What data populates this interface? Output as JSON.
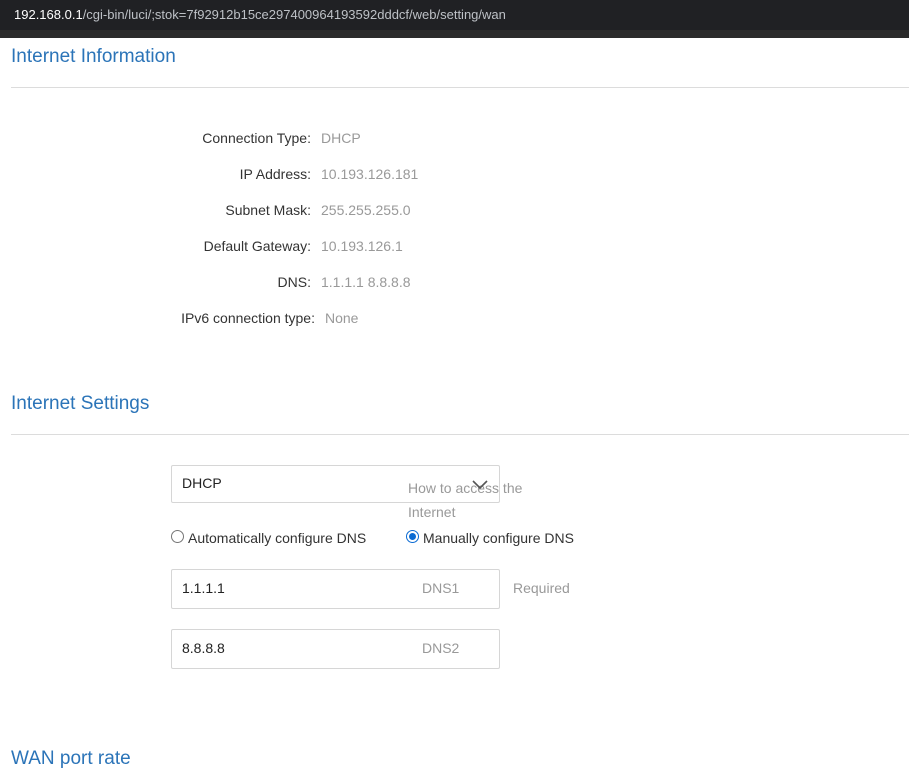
{
  "browser": {
    "url_host": "192.168.0.1",
    "url_path": "/cgi-bin/luci/;stok=7f92912b15ce297400964193592dddcf/web/setting/wan"
  },
  "internet_info": {
    "title": "Internet Information",
    "rows": [
      {
        "label": "Connection Type:",
        "value": "DHCP"
      },
      {
        "label": "IP Address:",
        "value": "10.193.126.181"
      },
      {
        "label": "Subnet Mask:",
        "value": "255.255.255.0"
      },
      {
        "label": "Default Gateway:",
        "value": "10.193.126.1"
      },
      {
        "label": "DNS:",
        "value": "1.1.1.1 8.8.8.8"
      },
      {
        "label": "IPv6 connection type:",
        "value": "None"
      }
    ]
  },
  "internet_settings": {
    "title": "Internet Settings",
    "access_select": {
      "value": "DHCP",
      "hint": "How to access the Internet"
    },
    "radio_auto": "Automatically configure DNS",
    "radio_manual": "Manually configure DNS",
    "dns_mode": "manual",
    "dns1": {
      "value": "1.1.1.1",
      "tag": "DNS1",
      "note": "Required"
    },
    "dns2": {
      "value": "8.8.8.8",
      "tag": "DNS2"
    }
  },
  "wan_port": {
    "title": "WAN port rate"
  },
  "colors": {
    "section_title": "#2b74b8",
    "radio_accent": "#0b6bd3"
  }
}
